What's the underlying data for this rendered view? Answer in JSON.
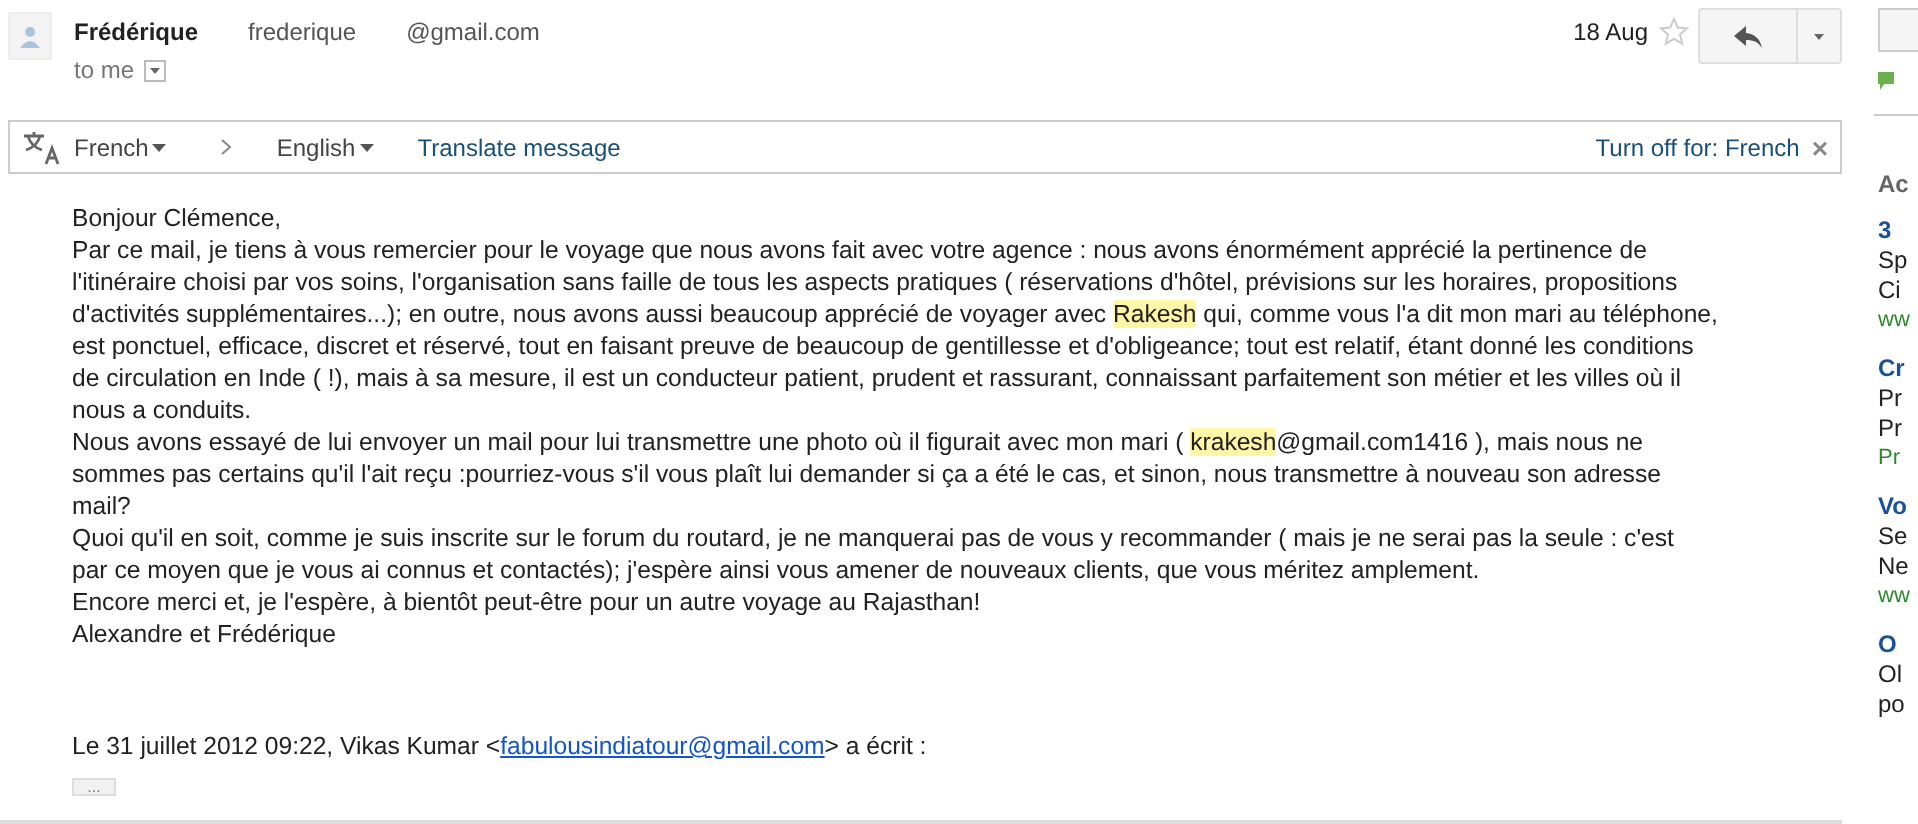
{
  "message": {
    "sender_name": "Frédérique",
    "sender_email_parts": [
      "frederique",
      "@gmail.com"
    ],
    "recipient": "to me",
    "date": "18 Aug",
    "starred": false
  },
  "translate_bar": {
    "source_language": "French",
    "target_language": "English",
    "translate_link": "Translate message",
    "turn_off_link": "Turn off for: French",
    "close": "×"
  },
  "body": {
    "paragraphs": [
      [
        [
          "Bonjour Clémence,"
        ]
      ],
      [
        [
          "Par ce mail, je tiens à vous remercier pour le voyage que nous avons fait avec votre agence : nous avons énormément apprécié la pertinence de"
        ],
        [
          "l'itinéraire choisi par vos soins, l'organisation sans faille de tous les aspects pratiques ( réservations d'hôtel, prévisions sur les horaires, propositions"
        ],
        [
          "d'activités supplémentaires...); en outre, nous avons aussi beaucoup apprécié de voyager avec ",
          {
            "text": "Rakesh",
            "highlighted": true
          },
          " qui, comme vous l'a dit mon mari au téléphone,"
        ],
        [
          "est ponctuel, efficace, discret et réservé, tout en faisant preuve de beaucoup de gentillesse et d'obligeance; tout est relatif, étant donné les conditions"
        ],
        [
          "de circulation en Inde ( !), mais à sa mesure, il est un conducteur patient, prudent et rassurant, connaissant parfaitement son métier et les villes où il"
        ],
        [
          "nous a conduits."
        ]
      ],
      [
        [
          "Nous avons essayé de lui envoyer un mail pour lui transmettre une photo où il figurait avec mon mari ( ",
          {
            "text": "krakesh",
            "highlighted": true
          },
          "@gmail.com1416 ), mais nous ne"
        ],
        [
          "sommes pas certains qu'il l'ait reçu :pourriez-vous s'il vous plaît lui demander si ça a été le cas, et sinon, nous transmettre à nouveau son adresse"
        ],
        [
          "mail?"
        ]
      ],
      [
        [
          "Quoi qu'il en soit, comme je suis inscrite sur le forum du routard, je ne manquerai pas de vous y recommander ( mais je ne serai pas la seule : c'est"
        ],
        [
          "par ce moyen que je vous ai connus et contactés); j'espère ainsi vous amener de nouveaux clients, que vous méritez amplement."
        ]
      ],
      [
        [
          "Encore merci et, je l'espère, à bientôt peut-être pour un autre voyage au Rajasthan!"
        ]
      ],
      [
        [
          "Alexandre et Frédérique"
        ]
      ]
    ],
    "quote_header": [
      "Le 31 juillet 2012 09:22, Vikas Kumar <",
      {
        "text": "fabulousindiatour@gmail.com",
        "link": true
      },
      "> a écrit :"
    ],
    "expand_quote": "..."
  },
  "sidebar": {
    "heading": "Ac",
    "ads": [
      {
        "title": "3",
        "lines": [
          "Sp",
          "Ci"
        ],
        "url": "ww"
      },
      {
        "title": "Cr",
        "lines": [
          "Pr",
          "Pr"
        ],
        "url": "Pr"
      },
      {
        "title": "Vo",
        "lines": [
          "Se",
          "Ne"
        ],
        "url": "ww"
      },
      {
        "title": "O",
        "lines": [
          "Ol",
          "po"
        ]
      }
    ]
  }
}
